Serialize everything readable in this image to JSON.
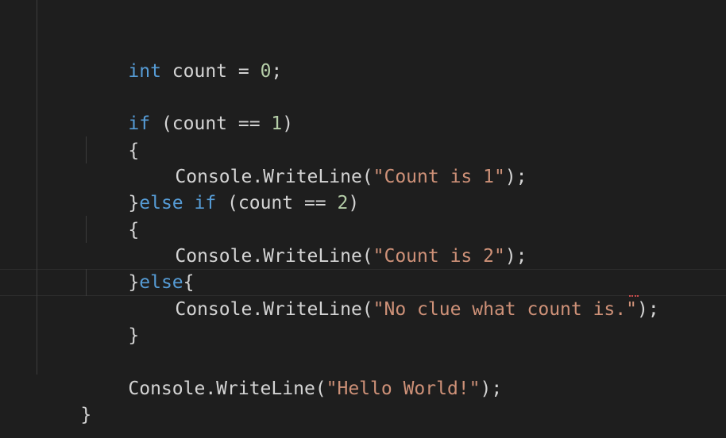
{
  "code": {
    "l1": {
      "kw": "int",
      "rest": " count = ",
      "num": "0",
      "end": ";"
    },
    "l2": {
      "kw": "if",
      "open": " (count == ",
      "num": "1",
      "close": ")"
    },
    "l3": {
      "brace": "{"
    },
    "l4": {
      "call": "Console.WriteLine(",
      "str": "\"Count is 1\"",
      "end": ");"
    },
    "l5": {
      "brace": "}",
      "kw": "else if",
      "open": " (count == ",
      "num": "2",
      "close": ")"
    },
    "l6": {
      "brace": "{"
    },
    "l7": {
      "call": "Console.WriteLine(",
      "str": "\"Count is 2\"",
      "end": ");"
    },
    "l8": {
      "brace": "}",
      "kw": "else",
      "brace2": "{"
    },
    "l9": {
      "call": "Console.WriteLine(",
      "str": "\"No clue what count is.\"",
      "end": ");"
    },
    "l10": {
      "brace": "}"
    },
    "l11": {
      "call": "Console.WriteLine(",
      "str": "\"Hello World!\"",
      "end": ");"
    },
    "l12": {
      "brace": "}"
    }
  },
  "colors": {
    "background": "#1e1e1e",
    "keyword": "#569cd6",
    "string": "#ce9178",
    "number": "#b5cea8",
    "text": "#d4d4d4"
  }
}
